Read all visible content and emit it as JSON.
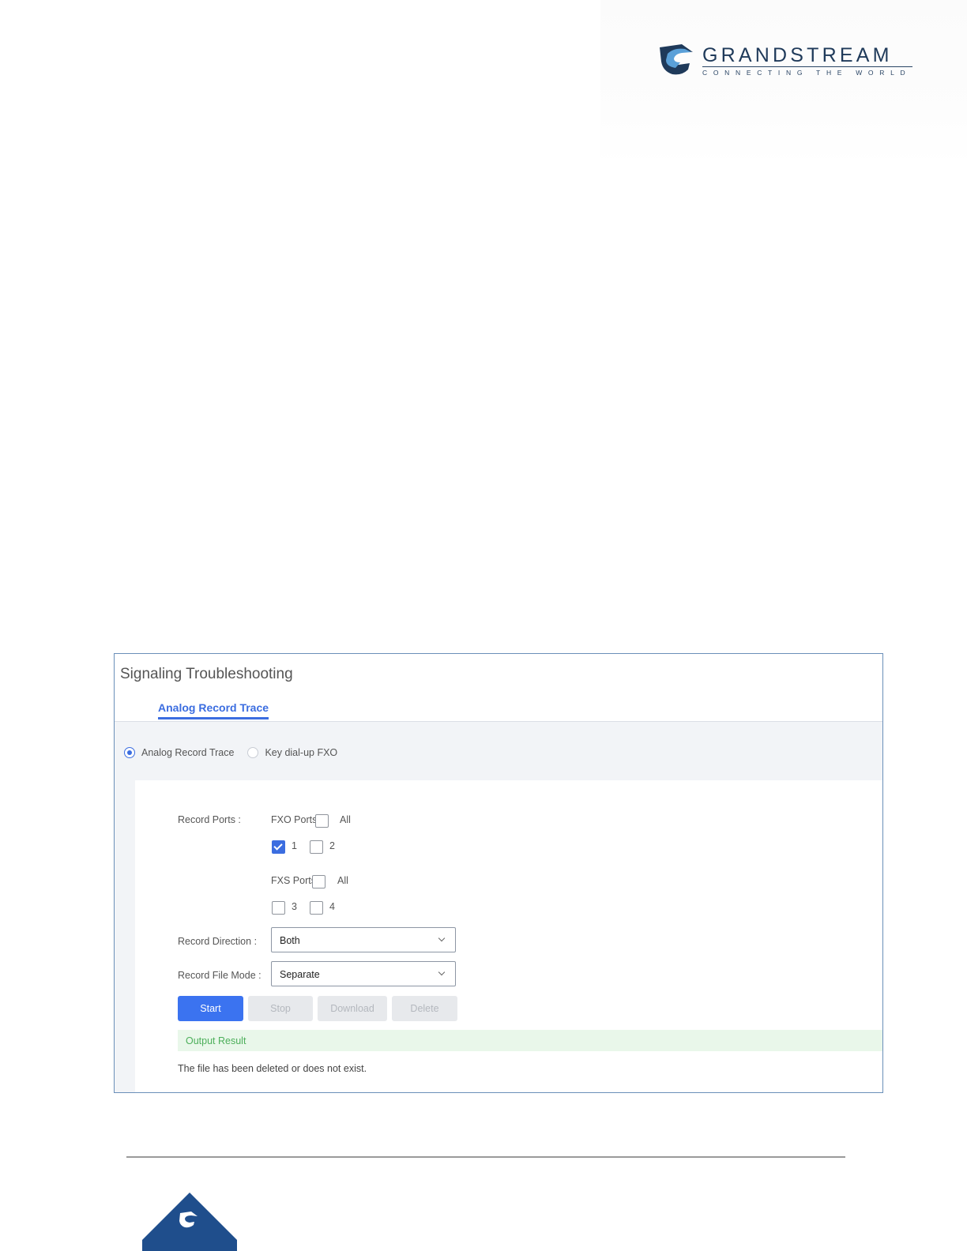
{
  "brand": {
    "name": "GRANDSTREAM",
    "tagline": "CONNECTING THE WORLD",
    "colors": {
      "navy": "#1f3a5a",
      "accent": "#3b6de0",
      "frame": "#6a8fb9"
    }
  },
  "screen": {
    "title": "Signaling Troubleshooting",
    "tabs": [
      {
        "label": "Analog Record Trace",
        "active": true
      }
    ],
    "mode_options": [
      {
        "label": "Analog Record Trace",
        "selected": true
      },
      {
        "label": "Key dial-up FXO",
        "selected": false
      }
    ],
    "record_ports": {
      "label": "Record Ports",
      "fxo": {
        "label": "FXO Ports",
        "all_label": "All",
        "all_checked": false,
        "ports": [
          {
            "label": "1",
            "checked": true
          },
          {
            "label": "2",
            "checked": false
          }
        ]
      },
      "fxs": {
        "label": "FXS Ports",
        "all_label": "All",
        "all_checked": false,
        "ports": [
          {
            "label": "3",
            "checked": false
          },
          {
            "label": "4",
            "checked": false
          }
        ]
      }
    },
    "record_direction": {
      "label": "Record Direction",
      "value": "Both"
    },
    "record_file_mode": {
      "label": "Record File Mode",
      "value": "Separate"
    },
    "buttons": {
      "start": "Start",
      "stop": "Stop",
      "download": "Download",
      "delete": "Delete"
    },
    "output": {
      "heading": "Output Result",
      "message": "The file has been deleted or does not exist."
    }
  }
}
